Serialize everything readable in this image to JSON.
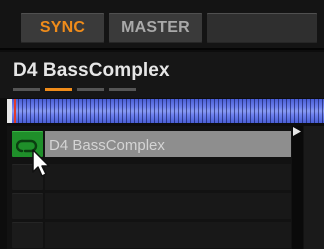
{
  "toolbar": {
    "sync_label": "SYNC",
    "master_label": "MASTER",
    "sync_color": "#f08c1a",
    "master_color": "#a9a9a9"
  },
  "deck": {
    "title": "D4 BassComplex",
    "segment_active_color": "#f08c1a",
    "segment_inactive_color": "#555555",
    "active_segment_index": 1
  },
  "waveform": {
    "color": "#6f82ee",
    "playhead_color": "#e13b2a"
  },
  "slots": [
    {
      "label": "D4 BassComplex",
      "active": true,
      "icon": "loop-icon",
      "active_color": "#1f8f2a"
    },
    {
      "label": "",
      "active": false
    },
    {
      "label": "",
      "active": false
    },
    {
      "label": "",
      "active": false
    },
    {
      "label": "",
      "active": false
    }
  ]
}
